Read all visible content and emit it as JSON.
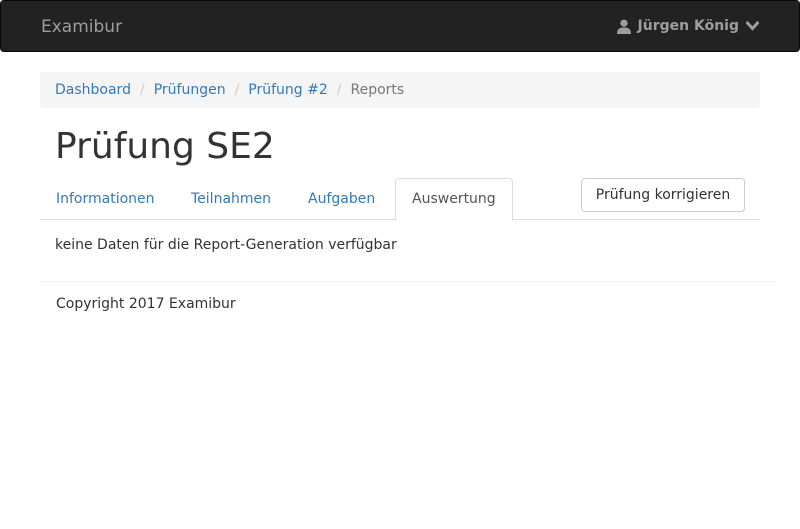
{
  "navbar": {
    "brand": "Examibur",
    "user": {
      "icon": "user-icon",
      "name": "Jürgen König",
      "caret_icon": "chevron-down-icon"
    }
  },
  "breadcrumb": {
    "items": [
      {
        "label": "Dashboard"
      },
      {
        "label": "Prüfungen"
      },
      {
        "label": "Prüfung #2"
      },
      {
        "label": "Reports"
      }
    ],
    "separator": "/"
  },
  "page": {
    "title": "Prüfung SE2"
  },
  "tabs": [
    {
      "label": "Informationen",
      "active": false
    },
    {
      "label": "Teilnahmen",
      "active": false
    },
    {
      "label": "Aufgaben",
      "active": false
    },
    {
      "label": "Auswertung",
      "active": true
    }
  ],
  "actions": {
    "correct_label": "Prüfung korrigieren"
  },
  "content": {
    "empty_message": "keine Daten für die Report-Generation verfügbar"
  },
  "footer": {
    "copyright": "Copyright 2017 Examibur"
  },
  "colors": {
    "navbar_bg": "#222222",
    "link": "#337ab7",
    "muted": "#9d9d9d"
  }
}
